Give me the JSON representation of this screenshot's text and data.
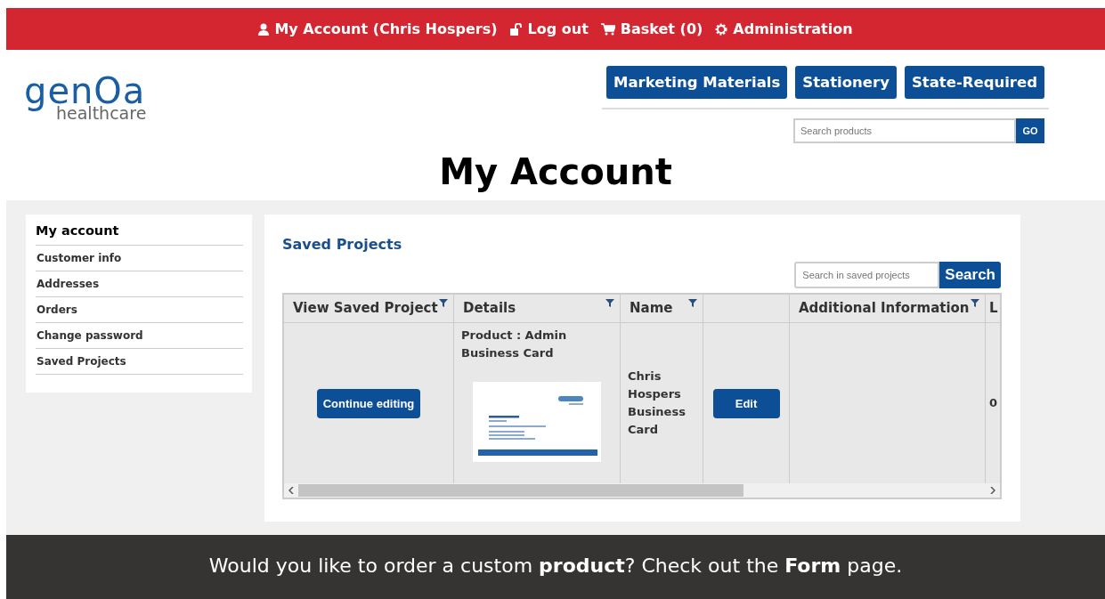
{
  "top_bar": {
    "links": [
      {
        "kind": "user",
        "label": "My Account (Chris Hospers)"
      },
      {
        "kind": "lock",
        "label": "Log out"
      },
      {
        "kind": "cart",
        "label": "Basket (0)"
      },
      {
        "kind": "gear",
        "label": "Administration"
      }
    ]
  },
  "logo": {
    "word": "genOa",
    "tagline": "healthcare"
  },
  "nav": [
    "Marketing Materials",
    "Stationery",
    "State-Required"
  ],
  "search": {
    "placeholder": "Search products",
    "button": "GO"
  },
  "page_title": "My Account",
  "sidebar": {
    "title": "My account",
    "items": [
      "Customer info",
      "Addresses",
      "Orders",
      "Change password",
      "Saved Projects"
    ]
  },
  "saved_projects": {
    "title": "Saved Projects",
    "search": {
      "placeholder": "Search in saved projects",
      "button": "Search"
    },
    "table": {
      "columns": [
        {
          "label": "View Saved Project",
          "filter": true
        },
        {
          "label": "Details",
          "filter": true
        },
        {
          "label": "Name",
          "filter": true
        },
        {
          "filter": false
        },
        {
          "label": "Additional Information",
          "filter": true
        },
        {
          "label": "L",
          "filter": false
        }
      ],
      "rows": [
        {
          "action": "Continue editing",
          "details": "Product : Admin Business Card",
          "name": "Chris Hospers Business Card",
          "edit": "Edit",
          "column_6": "0"
        }
      ]
    }
  },
  "footer": {
    "text": "Would you like to order a custom **product**? Check out the **Form** page."
  }
}
